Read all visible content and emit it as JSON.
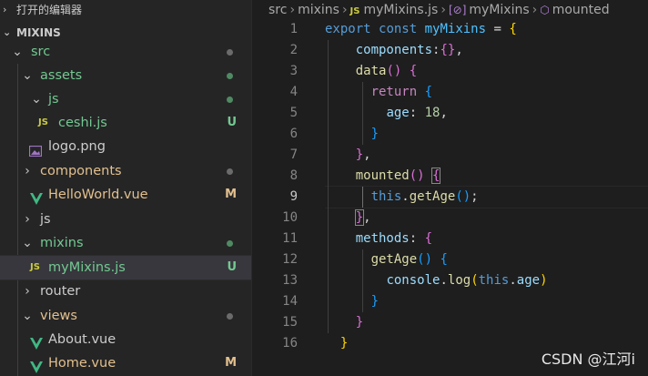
{
  "sidebar": {
    "open_editors_label": "打开的编辑器",
    "root_label": "MIXINS",
    "items": [
      {
        "name": "src",
        "type": "folder"
      },
      {
        "name": "assets",
        "type": "folder"
      },
      {
        "name": "js",
        "type": "folder"
      },
      {
        "name": "ceshi.js",
        "type": "js",
        "badge": "U"
      },
      {
        "name": "logo.png",
        "type": "image"
      },
      {
        "name": "components",
        "type": "folder"
      },
      {
        "name": "HelloWorld.vue",
        "type": "vue",
        "badge": "M"
      },
      {
        "name": "js",
        "type": "folder"
      },
      {
        "name": "mixins",
        "type": "folder"
      },
      {
        "name": "myMixins.js",
        "type": "js",
        "badge": "U"
      },
      {
        "name": "router",
        "type": "folder"
      },
      {
        "name": "views",
        "type": "folder"
      },
      {
        "name": "About.vue",
        "type": "vue"
      },
      {
        "name": "Home.vue",
        "type": "vue",
        "badge": "M"
      }
    ],
    "js_glyph": "JS"
  },
  "breadcrumb": [
    "src",
    "mixins",
    "myMixins.js",
    "myMixins",
    "mounted"
  ],
  "editor": {
    "line_numbers": [
      "1",
      "2",
      "3",
      "4",
      "5",
      "6",
      "7",
      "8",
      "9",
      "10",
      "11",
      "12",
      "13",
      "14",
      "15",
      "16"
    ],
    "active_line": "9"
  },
  "colors": {
    "untracked": "#73c991",
    "modified": "#e2c08d",
    "folder_default": "#cccccc",
    "dot_gray": "#6b6b6b",
    "vue_green": "#41b883",
    "js_yellow": "#cbcb41"
  },
  "icons": [
    "chevron-down-icon",
    "chevron-right-icon",
    "js-file-icon",
    "vue-file-icon",
    "image-file-icon",
    "symbol-variable-icon",
    "symbol-method-icon"
  ],
  "watermark": "CSDN @江河i"
}
